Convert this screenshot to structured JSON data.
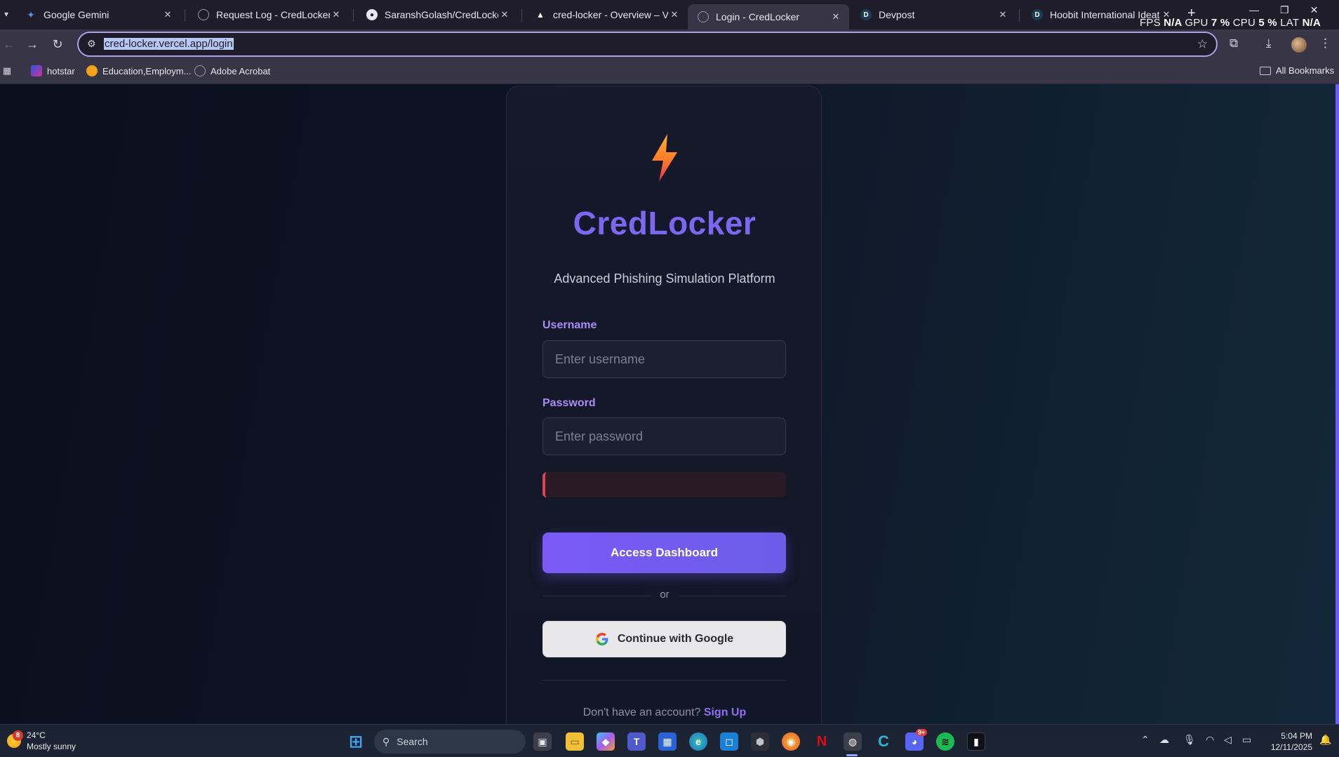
{
  "browser": {
    "tabs": [
      {
        "label": "Google Gemini",
        "icon": "gemini-icon",
        "active": false
      },
      {
        "label": "Request Log - CredLocker",
        "icon": "globe-icon",
        "active": false
      },
      {
        "label": "SaranshGolash/CredLocker",
        "icon": "github-icon",
        "active": false
      },
      {
        "label": "cred-locker - Overview – Vercel",
        "icon": "vercel-icon",
        "active": false
      },
      {
        "label": "Login - CredLocker",
        "icon": "globe-icon",
        "active": true
      },
      {
        "label": "Devpost",
        "icon": "devpost-icon",
        "active": false
      },
      {
        "label": "Hoobit International Ideathon:",
        "icon": "devpost-icon",
        "active": false
      }
    ],
    "new_tab_glyph": "+",
    "close_glyph": "✕",
    "perf_overlay": {
      "fps_label": "FPS",
      "fps_value": "N/A",
      "gpu_label": "GPU",
      "gpu_value": "7 %",
      "cpu_label": "CPU",
      "cpu_value": "5 %",
      "lat_label": "LAT",
      "lat_value": "N/A"
    },
    "url": "cred-locker.vercel.app/login",
    "bookmarks": [
      {
        "label": "hotstar",
        "icon": "hotstar-icon"
      },
      {
        "label": "Education,Employm...",
        "icon": "education-icon"
      },
      {
        "label": "Adobe Acrobat",
        "icon": "globe-icon"
      }
    ],
    "all_bookmarks_label": "All Bookmarks"
  },
  "login": {
    "brand": "CredLocker",
    "subtitle": "Advanced Phishing Simulation Platform",
    "username_label": "Username",
    "username_placeholder": "Enter username",
    "username_value": "",
    "password_label": "Password",
    "password_placeholder": "Enter password",
    "password_value": "",
    "error_message": "",
    "submit_label": "Access Dashboard",
    "divider_text": "or",
    "google_label": "Continue with Google",
    "signup_prompt": "Don't have an account?",
    "signup_link": "Sign Up"
  },
  "colors": {
    "accent": "#7d67ee",
    "label": "#a98cf6",
    "error": "#e2404e",
    "page_bg": "#0d1220"
  },
  "taskbar": {
    "weather_temp": "24°C",
    "weather_desc": "Mostly sunny",
    "weather_badge": "8",
    "search_label": "Search",
    "time": "5:04 PM",
    "date": "12/11/2025",
    "discord_badge": "9+"
  }
}
